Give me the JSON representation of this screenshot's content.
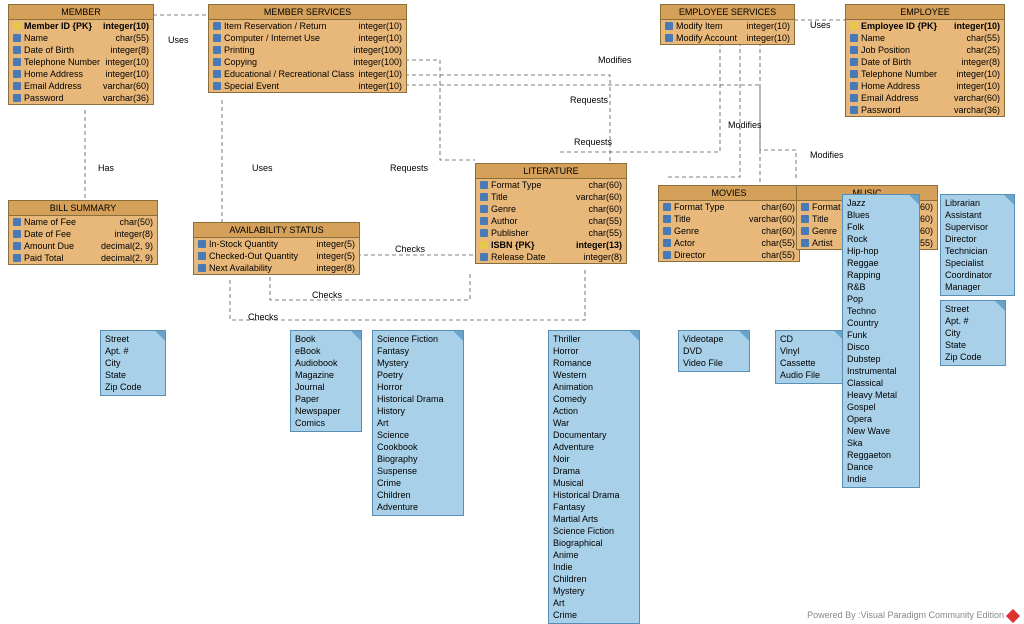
{
  "entities": {
    "member": {
      "title": "MEMBER",
      "fields": [
        {
          "pk": true,
          "name": "Member ID {PK}",
          "type": "integer(10)"
        },
        {
          "name": "Name",
          "type": "char(55)"
        },
        {
          "name": "Date of Birth",
          "type": "integer(8)"
        },
        {
          "name": "Telephone Number",
          "type": "integer(10)"
        },
        {
          "name": "Home Address",
          "type": "integer(10)"
        },
        {
          "name": "Email Address",
          "type": "varchar(60)"
        },
        {
          "name": "Password",
          "type": "varchar(36)"
        }
      ]
    },
    "memberServices": {
      "title": "MEMBER SERVICES",
      "fields": [
        {
          "name": "Item Reservation / Return",
          "type": "integer(10)"
        },
        {
          "name": "Computer / Internet Use",
          "type": "integer(10)"
        },
        {
          "name": "Printing",
          "type": "integer(100)"
        },
        {
          "name": "Copying",
          "type": "integer(100)"
        },
        {
          "name": "Educational / Recreational Class",
          "type": "integer(10)"
        },
        {
          "name": "Special Event",
          "type": "integer(10)"
        }
      ]
    },
    "employeeServices": {
      "title": "EMPLOYEE SERVICES",
      "fields": [
        {
          "name": "Modify Item",
          "type": "integer(10)"
        },
        {
          "name": "Modify Account",
          "type": "integer(10)"
        }
      ]
    },
    "employee": {
      "title": "EMPLOYEE",
      "fields": [
        {
          "pk": true,
          "name": "Employee ID {PK}",
          "type": "integer(10)"
        },
        {
          "name": "Name",
          "type": "char(55)"
        },
        {
          "name": "Job Position",
          "type": "char(25)"
        },
        {
          "name": "Date of Birth",
          "type": "integer(8)"
        },
        {
          "name": "Telephone Number",
          "type": "integer(10)"
        },
        {
          "name": "Home Address",
          "type": "integer(10)"
        },
        {
          "name": "Email Address",
          "type": "varchar(60)"
        },
        {
          "name": "Password",
          "type": "varchar(36)"
        }
      ]
    },
    "billSummary": {
      "title": "BILL SUMMARY",
      "fields": [
        {
          "name": "Name of Fee",
          "type": "char(50)"
        },
        {
          "name": "Date of Fee",
          "type": "integer(8)"
        },
        {
          "name": "Amount Due",
          "type": "decimal(2, 9)"
        },
        {
          "name": "Paid Total",
          "type": "decimal(2, 9)"
        }
      ]
    },
    "availabilityStatus": {
      "title": "AVAILABILITY STATUS",
      "fields": [
        {
          "name": "In-Stock Quantity",
          "type": "integer(5)"
        },
        {
          "name": "Checked-Out Quantity",
          "type": "integer(5)"
        },
        {
          "name": "Next Availability",
          "type": "integer(8)"
        }
      ]
    },
    "literature": {
      "title": "LITERATURE",
      "fields": [
        {
          "name": "Format Type",
          "type": "char(60)"
        },
        {
          "name": "Title",
          "type": "varchar(60)"
        },
        {
          "name": "Genre",
          "type": "char(60)"
        },
        {
          "name": "Author",
          "type": "char(55)"
        },
        {
          "name": "Publisher",
          "type": "char(55)"
        },
        {
          "pk": true,
          "name": "ISBN {PK}",
          "type": "integer(13)"
        },
        {
          "name": "Release Date",
          "type": "integer(8)"
        }
      ]
    },
    "movies": {
      "title": "MOVIES",
      "fields": [
        {
          "name": "Format Type",
          "type": "char(60)"
        },
        {
          "name": "Title",
          "type": "varchar(60)"
        },
        {
          "name": "Genre",
          "type": "char(60)"
        },
        {
          "name": "Actor",
          "type": "char(55)"
        },
        {
          "name": "Director",
          "type": "char(55)"
        }
      ]
    },
    "music": {
      "title": "MUSIC",
      "fields": [
        {
          "name": "Format Type",
          "type": "char(60)"
        },
        {
          "name": "Title",
          "type": "varchar(60)"
        },
        {
          "name": "Genre",
          "type": "char(60)"
        },
        {
          "name": "Artist",
          "type": "char(55)"
        }
      ]
    }
  },
  "notes": {
    "addr1": [
      "Street",
      "Apt. #",
      "City",
      "State",
      "Zip Code"
    ],
    "bookFmt": [
      "Book",
      "eBook",
      "Audiobook",
      "Magazine",
      "Journal",
      "Paper",
      "Newspaper",
      "Comics"
    ],
    "litGenre": [
      "Science Fiction",
      "Fantasy",
      "Mystery",
      "Poetry",
      "Horror",
      "Historical Drama",
      "History",
      "Art",
      "Science",
      "Cookbook",
      "Biography",
      "Suspense",
      "Crime",
      "Children",
      "Adventure"
    ],
    "movGenre": [
      "Thriller",
      "Horror",
      "Romance",
      "Western",
      "Animation",
      "Comedy",
      "Action",
      "War",
      "Documentary",
      "Adventure",
      "Noir",
      "Drama",
      "Musical",
      "Historical Drama",
      "Fantasy",
      "Martial Arts",
      "Science Fiction",
      "Biographical",
      "Anime",
      "Indie",
      "Children",
      "Mystery",
      "Art",
      "Crime"
    ],
    "movFmt": [
      "Videotape",
      "DVD",
      "Video File"
    ],
    "musFmt": [
      "CD",
      "Vinyl",
      "Cassette",
      "Audio File"
    ],
    "musGenre": [
      "Jazz",
      "Blues",
      "Folk",
      "Rock",
      "Hip-hop",
      "Reggae",
      "Rapping",
      "R&B",
      "Pop",
      "Techno",
      "Country",
      "Funk",
      "Disco",
      "Dubstep",
      "Instrumental",
      "Classical",
      "Heavy Metal",
      "Gospel",
      "Opera",
      "New Wave",
      "Ska",
      "Reggaeton",
      "Dance",
      "Indie"
    ],
    "jobPos": [
      "Librarian",
      "Assistant",
      "Supervisor",
      "Director",
      "Technician",
      "Specialist",
      "Coordinator",
      "Manager"
    ],
    "addr2": [
      "Street",
      "Apt. #",
      "City",
      "State",
      "Zip Code"
    ]
  },
  "labels": {
    "uses1": "Uses",
    "has": "Has",
    "uses2": "Uses",
    "requests1": "Requests",
    "requests2": "Requests",
    "requests3": "Requests",
    "checks1": "Checks",
    "checks2": "Checks",
    "checks3": "Checks",
    "modifies1": "Modifies",
    "modifies2": "Modifies",
    "modifies3": "Modifies",
    "uses3": "Uses"
  },
  "footer": "Powered By :Visual Paradigm Community Edition"
}
